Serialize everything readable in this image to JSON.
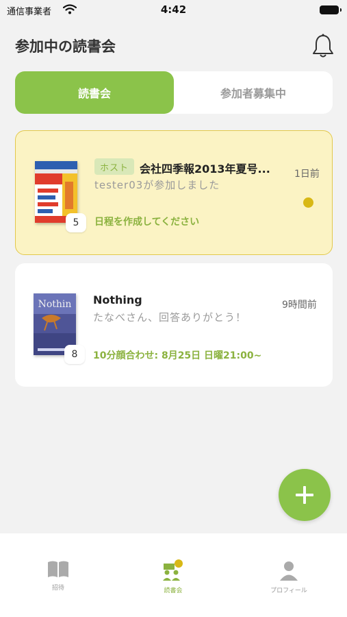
{
  "status_bar": {
    "carrier": "通信事業者",
    "time": "4:42"
  },
  "header": {
    "title": "参加中の読書会"
  },
  "tabs": [
    {
      "label": "読書会",
      "active": true
    },
    {
      "label": "参加者募集中",
      "active": false
    }
  ],
  "groups": [
    {
      "host_badge": "ホスト",
      "title": "会社四季報2013年夏号...",
      "message": "tester03が参加しました",
      "action": "日程を作成してください",
      "time": "1日前",
      "member_count": "5",
      "unread": true
    },
    {
      "title": "Nothing",
      "message": "たなべさん、回答ありがとう！",
      "action": "10分顔合わせ: 8月25日 日曜21:00~",
      "time": "9時間前",
      "member_count": "8",
      "unread": false
    }
  ],
  "bottom_nav": [
    {
      "label": "招待",
      "icon": "book-open-icon",
      "active": false
    },
    {
      "label": "読書会",
      "icon": "group-icon",
      "active": true
    },
    {
      "label": "プロフィール",
      "icon": "person-icon",
      "active": false
    }
  ],
  "colors": {
    "accent": "#8bc34a",
    "highlight_card": "#fbf3c4",
    "unread_dot": "#d8b815",
    "background": "#f2f2f2"
  }
}
